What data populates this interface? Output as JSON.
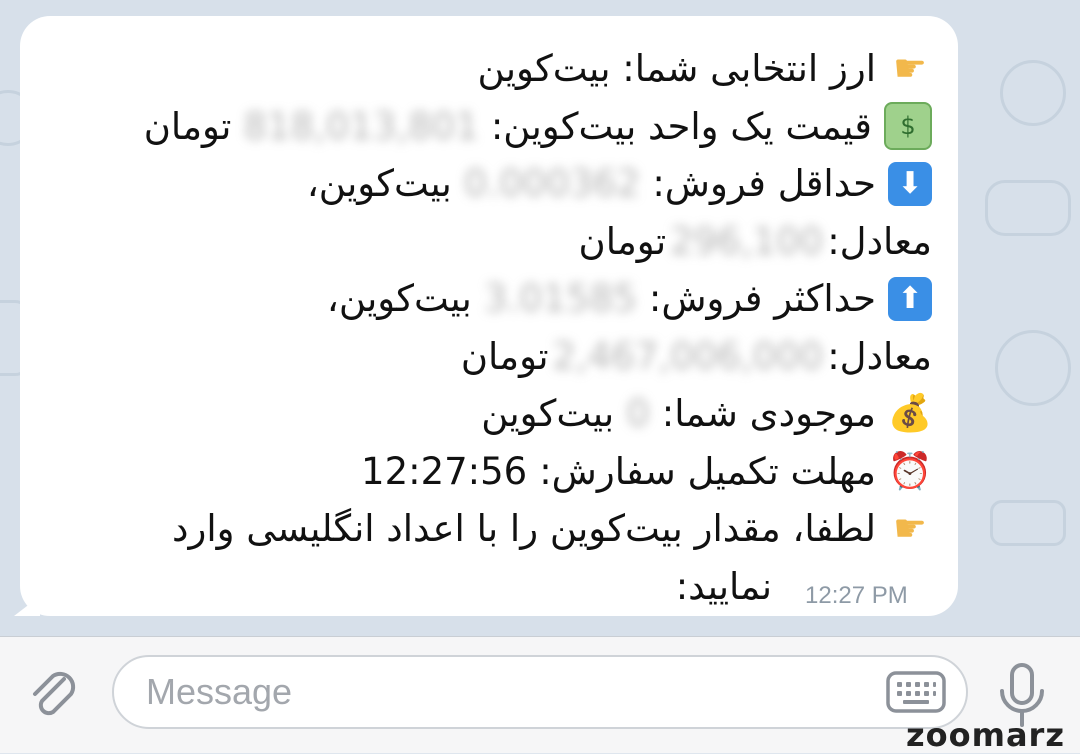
{
  "message": {
    "line1": {
      "label": "ارز انتخابی شما: بیت‌کوین"
    },
    "line2": {
      "label": "قیمت یک واحد بیت‌کوین:",
      "value": "818,013,801",
      "unit": "تومان"
    },
    "line3": {
      "label": "حداقل فروش:",
      "value": "0.000362",
      "unit": "بیت‌کوین،"
    },
    "line4": {
      "label": "معادل:",
      "value": "296,100",
      "unit": "تومان"
    },
    "line5": {
      "label": "حداکثر فروش:",
      "value": "3.01585",
      "unit": "بیت‌کوین،"
    },
    "line6": {
      "label": "معادل:",
      "value": "2,467,006,000",
      "unit": "تومان"
    },
    "line7": {
      "label": "موجودی شما:",
      "value": "0",
      "unit": "بیت‌کوین"
    },
    "line8": {
      "label": "مهلت تکمیل سفارش:",
      "value": "12:27:56"
    },
    "line9": {
      "label": "لطفا، مقدار بیت‌کوین را با اعداد انگلیسی وارد"
    },
    "line10": {
      "label": "نمایید:"
    },
    "timestamp": "12:27 PM"
  },
  "composer": {
    "placeholder": "Message"
  },
  "watermark": "zoomarz",
  "icons": {
    "hand": "backhand-index-pointing-left-icon",
    "money": "dollar-banknote-icon",
    "down": "down-arrow-icon",
    "up": "up-arrow-icon",
    "bag": "money-bag-icon",
    "alarm": "alarm-clock-icon"
  }
}
